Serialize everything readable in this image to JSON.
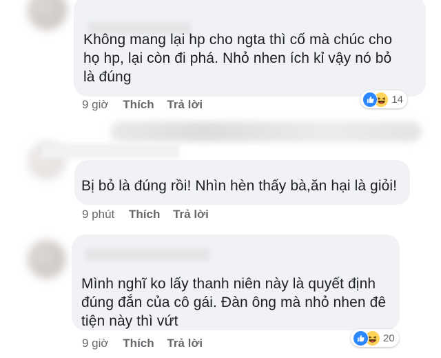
{
  "comments": [
    {
      "text_lines": [
        "Không mang lại hp cho ngta thì cố mà chúc cho",
        "họ hp, lại còn đi phá. Nhỏ nhen ích kỉ vậy nó bỏ",
        "là đúng"
      ],
      "time": "9 giờ",
      "like_label": "Thích",
      "reply_label": "Trả lời",
      "reaction_count": "14",
      "reactions": [
        "like-icon",
        "haha-icon"
      ]
    },
    {
      "text_lines": [
        "Bị bỏ là đúng rồi! Nhìn hèn thấy bà,ăn hại là giỏi!"
      ],
      "time": "9 phút",
      "like_label": "Thích",
      "reply_label": "Trả lời"
    },
    {
      "text_lines": [
        "Mình nghĩ ko lấy thanh niên này là quyết định",
        "đúng đắn của cô gái. Đàn ông mà nhỏ nhen đê",
        "tiện này thì vứt"
      ],
      "time": "9 giờ",
      "like_label": "Thích",
      "reply_label": "Trả lời",
      "reaction_count": "20",
      "reactions": [
        "like-icon",
        "haha-icon"
      ]
    }
  ],
  "colors": {
    "bubble": "#f0f2f5",
    "meta": "#65676b",
    "text": "#1c1e21",
    "like": "#2d88ff",
    "haha": "#ffd25a"
  }
}
